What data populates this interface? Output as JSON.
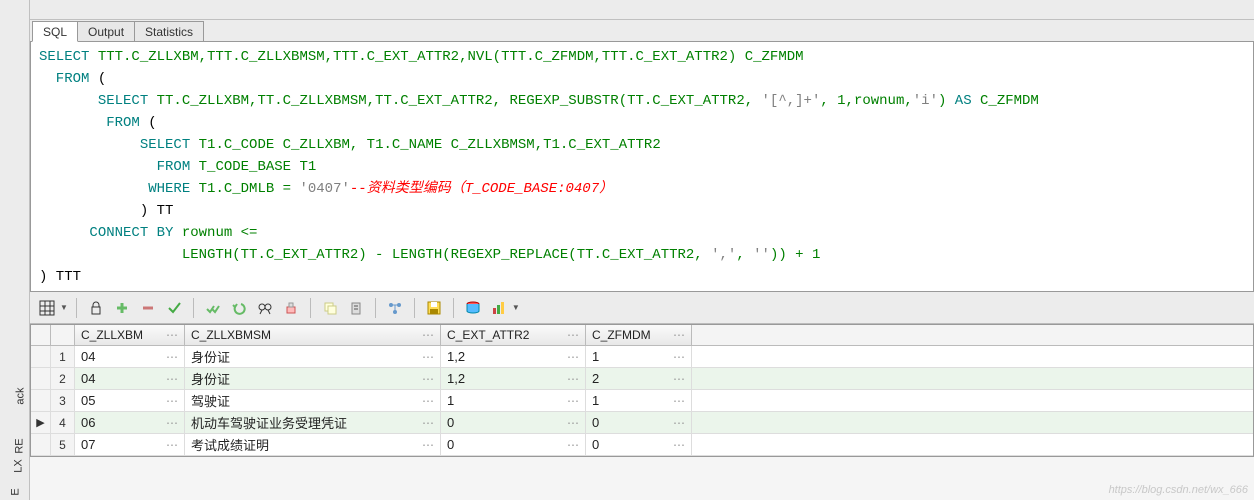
{
  "tabs": {
    "sql": "SQL",
    "output": "Output",
    "statistics": "Statistics"
  },
  "sql": {
    "l1": {
      "kw1": "SELECT ",
      "id": "TTT.C_ZLLXBM,TTT.C_ZLLXBMSM,TTT.C_EXT_ATTR2,NVL(TTT.C_ZFMDM,TTT.C_EXT_ATTR2) C_ZFMDM"
    },
    "l2": {
      "kw1": "  FROM ",
      "p": "("
    },
    "l3": {
      "pad": "       ",
      "kw": "SELECT ",
      "id": "TT.C_ZLLXBM,TT.C_ZLLXBMSM,TT.C_EXT_ATTR2, REGEXP_SUBSTR(TT.C_EXT_ATTR2, ",
      "str": "'[^,]+'",
      "id2": ", 1,rownum,",
      "str2": "'i'",
      "id3": ") ",
      "as": "AS ",
      "id4": "C_ZFMDM"
    },
    "l4": {
      "pad": "        ",
      "kw": "FROM ",
      "p": "("
    },
    "l5": {
      "pad": "            ",
      "kw": "SELECT ",
      "id": "T1.C_CODE C_ZLLXBM, T1.C_NAME C_ZLLXBMSM,T1.C_EXT_ATTR2"
    },
    "l6": {
      "pad": "              ",
      "kw": "FROM ",
      "id": "T_CODE_BASE T1"
    },
    "l7": {
      "pad": "             ",
      "kw": "WHERE ",
      "id": "T1.C_DMLB = ",
      "str": "'0407'",
      "cmt": "--资料类型编码（T_CODE_BASE:0407）"
    },
    "l8": {
      "pad": "            ",
      "p": ") TT"
    },
    "l9": {
      "pad": "      ",
      "kw": "CONNECT BY ",
      "id": "rownum <="
    },
    "l10": {
      "pad": "                 ",
      "id": "LENGTH(TT.C_EXT_ATTR2) - LENGTH(REGEXP_REPLACE(TT.C_EXT_ATTR2, ",
      "str": "','",
      "id2": ", ",
      "str2": "''",
      "id3": ")) + 1"
    },
    "l11": {
      "p": ") TTT"
    }
  },
  "columns": {
    "c1": "C_ZLLXBM",
    "c2": "C_ZLLXBMSM",
    "c3": "C_EXT_ATTR2",
    "c4": "C_ZFMDM"
  },
  "rows": [
    {
      "n": "1",
      "c1": "04",
      "c2": "身份证",
      "c3": "1,2",
      "c4": "1"
    },
    {
      "n": "2",
      "c1": "04",
      "c2": "身份证",
      "c3": "1,2",
      "c4": "2"
    },
    {
      "n": "3",
      "c1": "05",
      "c2": "驾驶证",
      "c3": "1",
      "c4": "1"
    },
    {
      "n": "4",
      "c1": "06",
      "c2": "机动车驾驶证业务受理凭证",
      "c3": "0",
      "c4": "0"
    },
    {
      "n": "5",
      "c1": "07",
      "c2": "考试成绩证明",
      "c3": "0",
      "c4": "0"
    }
  ],
  "watermark": "https://blog.csdn.net/wx_666",
  "gutter": {
    "t1": "ack",
    "t2": "RE",
    "t3": "LX",
    "t4": "E"
  },
  "toolbar_icons": {
    "grid": "grid-icon",
    "lock": "lock-icon",
    "plus": "plus-icon",
    "minus": "minus-icon",
    "check": "check-icon",
    "checks": "double-check-icon",
    "undo": "undo-icon",
    "binoculars": "binoculars-icon",
    "eraser": "eraser-icon",
    "copy": "copy-icon",
    "calc": "calculator-icon",
    "link": "link-icon",
    "save": "save-floppy-icon",
    "db": "database-icon",
    "chart": "chart-icon"
  }
}
